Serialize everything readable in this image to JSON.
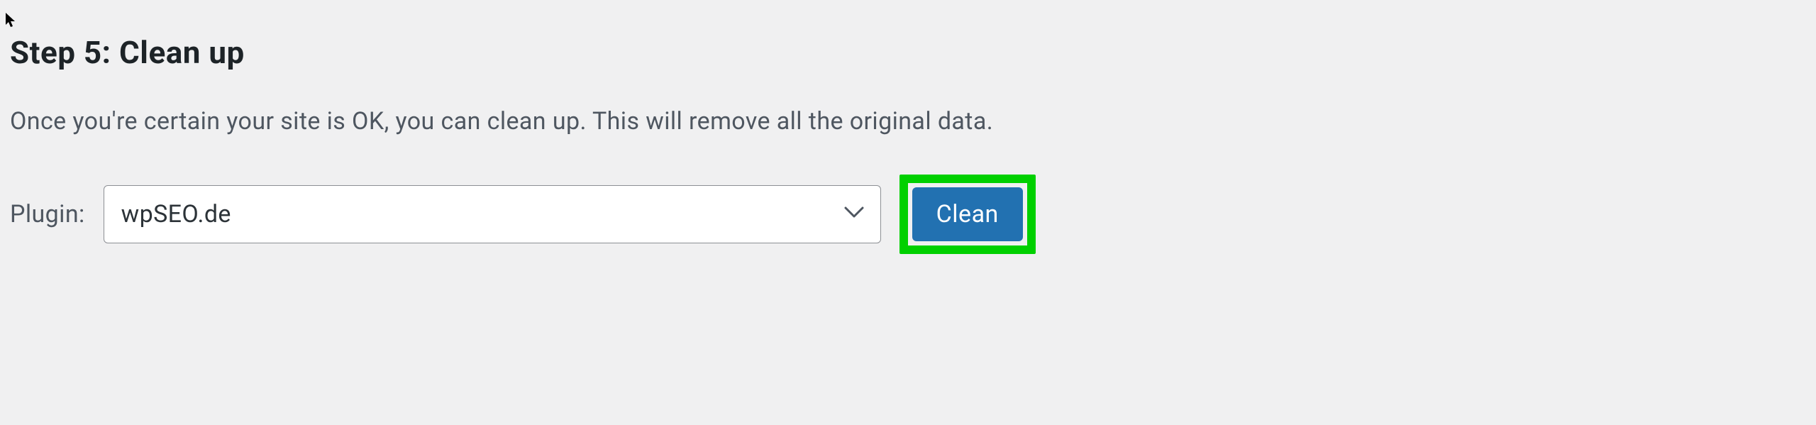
{
  "heading": "Step 5: Clean up",
  "description": "Once you're certain your site is OK, you can clean up. This will remove all the original data.",
  "form": {
    "label": "Plugin:",
    "select_value": "wpSEO.de",
    "button_label": "Clean"
  }
}
